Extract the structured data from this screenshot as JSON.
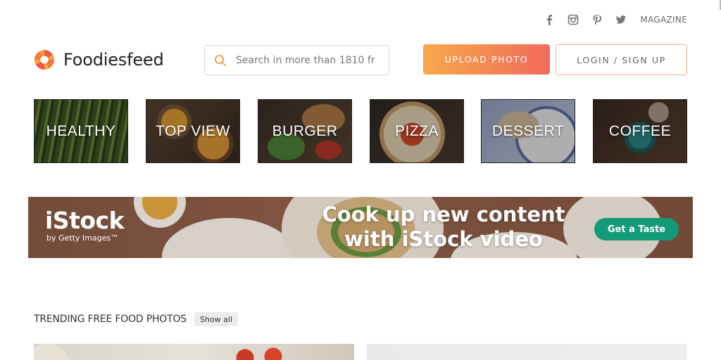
{
  "header": {
    "social": [
      {
        "icon": "facebook-icon",
        "label": "f"
      },
      {
        "icon": "instagram-icon",
        "label": ""
      },
      {
        "icon": "pinterest-icon",
        "label": ""
      },
      {
        "icon": "twitter-icon",
        "label": ""
      }
    ],
    "magazine_label": "MAGAZINE",
    "logo_text": "Foodiesfeed",
    "search_placeholder": "Search in more than 1810 fr",
    "upload_label": "UPLOAD PHOTO",
    "login_label": "LOGIN / SIGN UP",
    "accent_gradient": [
      "#f7a84a",
      "#f36a5d"
    ]
  },
  "categories": [
    {
      "label": "HEALTHY"
    },
    {
      "label": "TOP VIEW"
    },
    {
      "label": "BURGER"
    },
    {
      "label": "PIZZA"
    },
    {
      "label": "DESSERT"
    },
    {
      "label": "COFFEE"
    }
  ],
  "banner": {
    "brand": "iStock",
    "brand_sub": "by Getty Images™",
    "headline_line1": "Cook up new content",
    "headline_line2": "with iStock video",
    "cta_label": "Get a Taste",
    "cta_color": "#139a78"
  },
  "trending": {
    "title": "TRENDING FREE FOOD PHOTOS",
    "show_all_label": "Show all"
  }
}
